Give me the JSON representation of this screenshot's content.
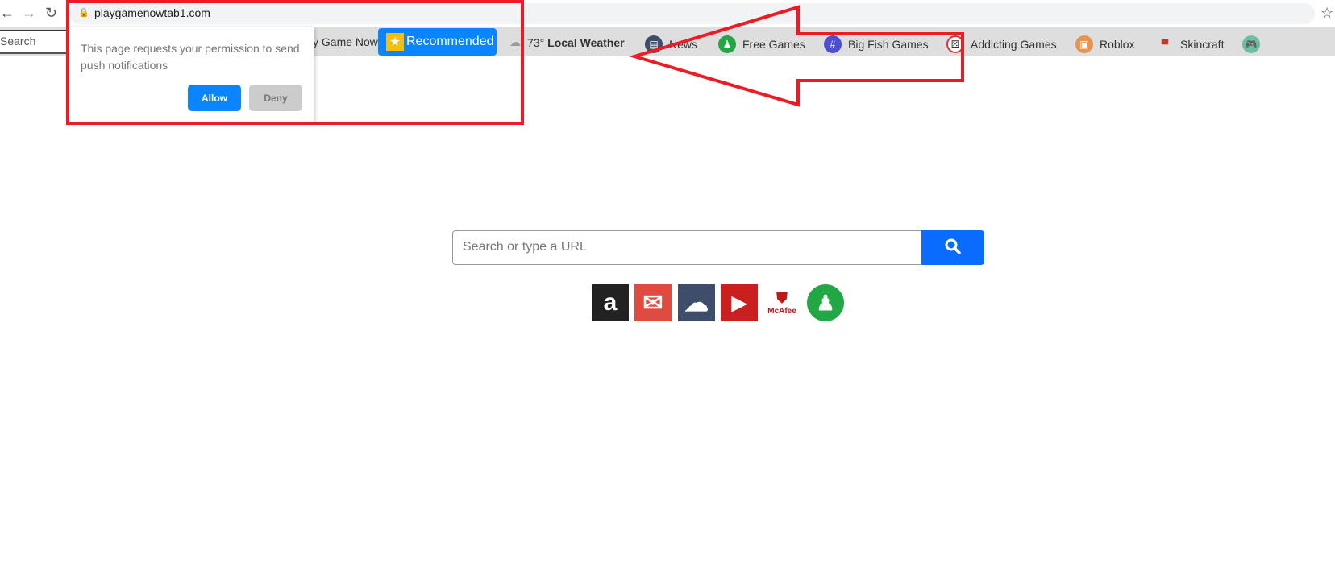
{
  "browser": {
    "url": "playgamenowtab1.com"
  },
  "toolbar": {
    "search_placeholder": "Search",
    "items": [
      {
        "label": "y Game Now"
      },
      {
        "label": "Recommended"
      },
      {
        "label": "73°",
        "bold": "Local Weather"
      },
      {
        "label": "News"
      },
      {
        "label": "Free Games"
      },
      {
        "label": "Big Fish Games"
      },
      {
        "label": "Addicting Games"
      },
      {
        "label": "Roblox"
      },
      {
        "label": "Skincraft"
      }
    ]
  },
  "popup": {
    "text": "This page requests your permission to send push notifications",
    "allow": "Allow",
    "deny": "Deny"
  },
  "main": {
    "search_placeholder": "Search or type a URL",
    "shortcuts": [
      {
        "name": "Amazon",
        "glyph": "a"
      },
      {
        "name": "Gmail",
        "glyph": "✉"
      },
      {
        "name": "Weather",
        "glyph": "☁"
      },
      {
        "name": "YouTube",
        "glyph": "▶"
      },
      {
        "name": "McAfee",
        "glyph": "McAfee"
      },
      {
        "name": "Games",
        "glyph": "♟"
      }
    ]
  },
  "colors": {
    "accent": "#0a84ff",
    "annotation": "#ed1c24"
  }
}
